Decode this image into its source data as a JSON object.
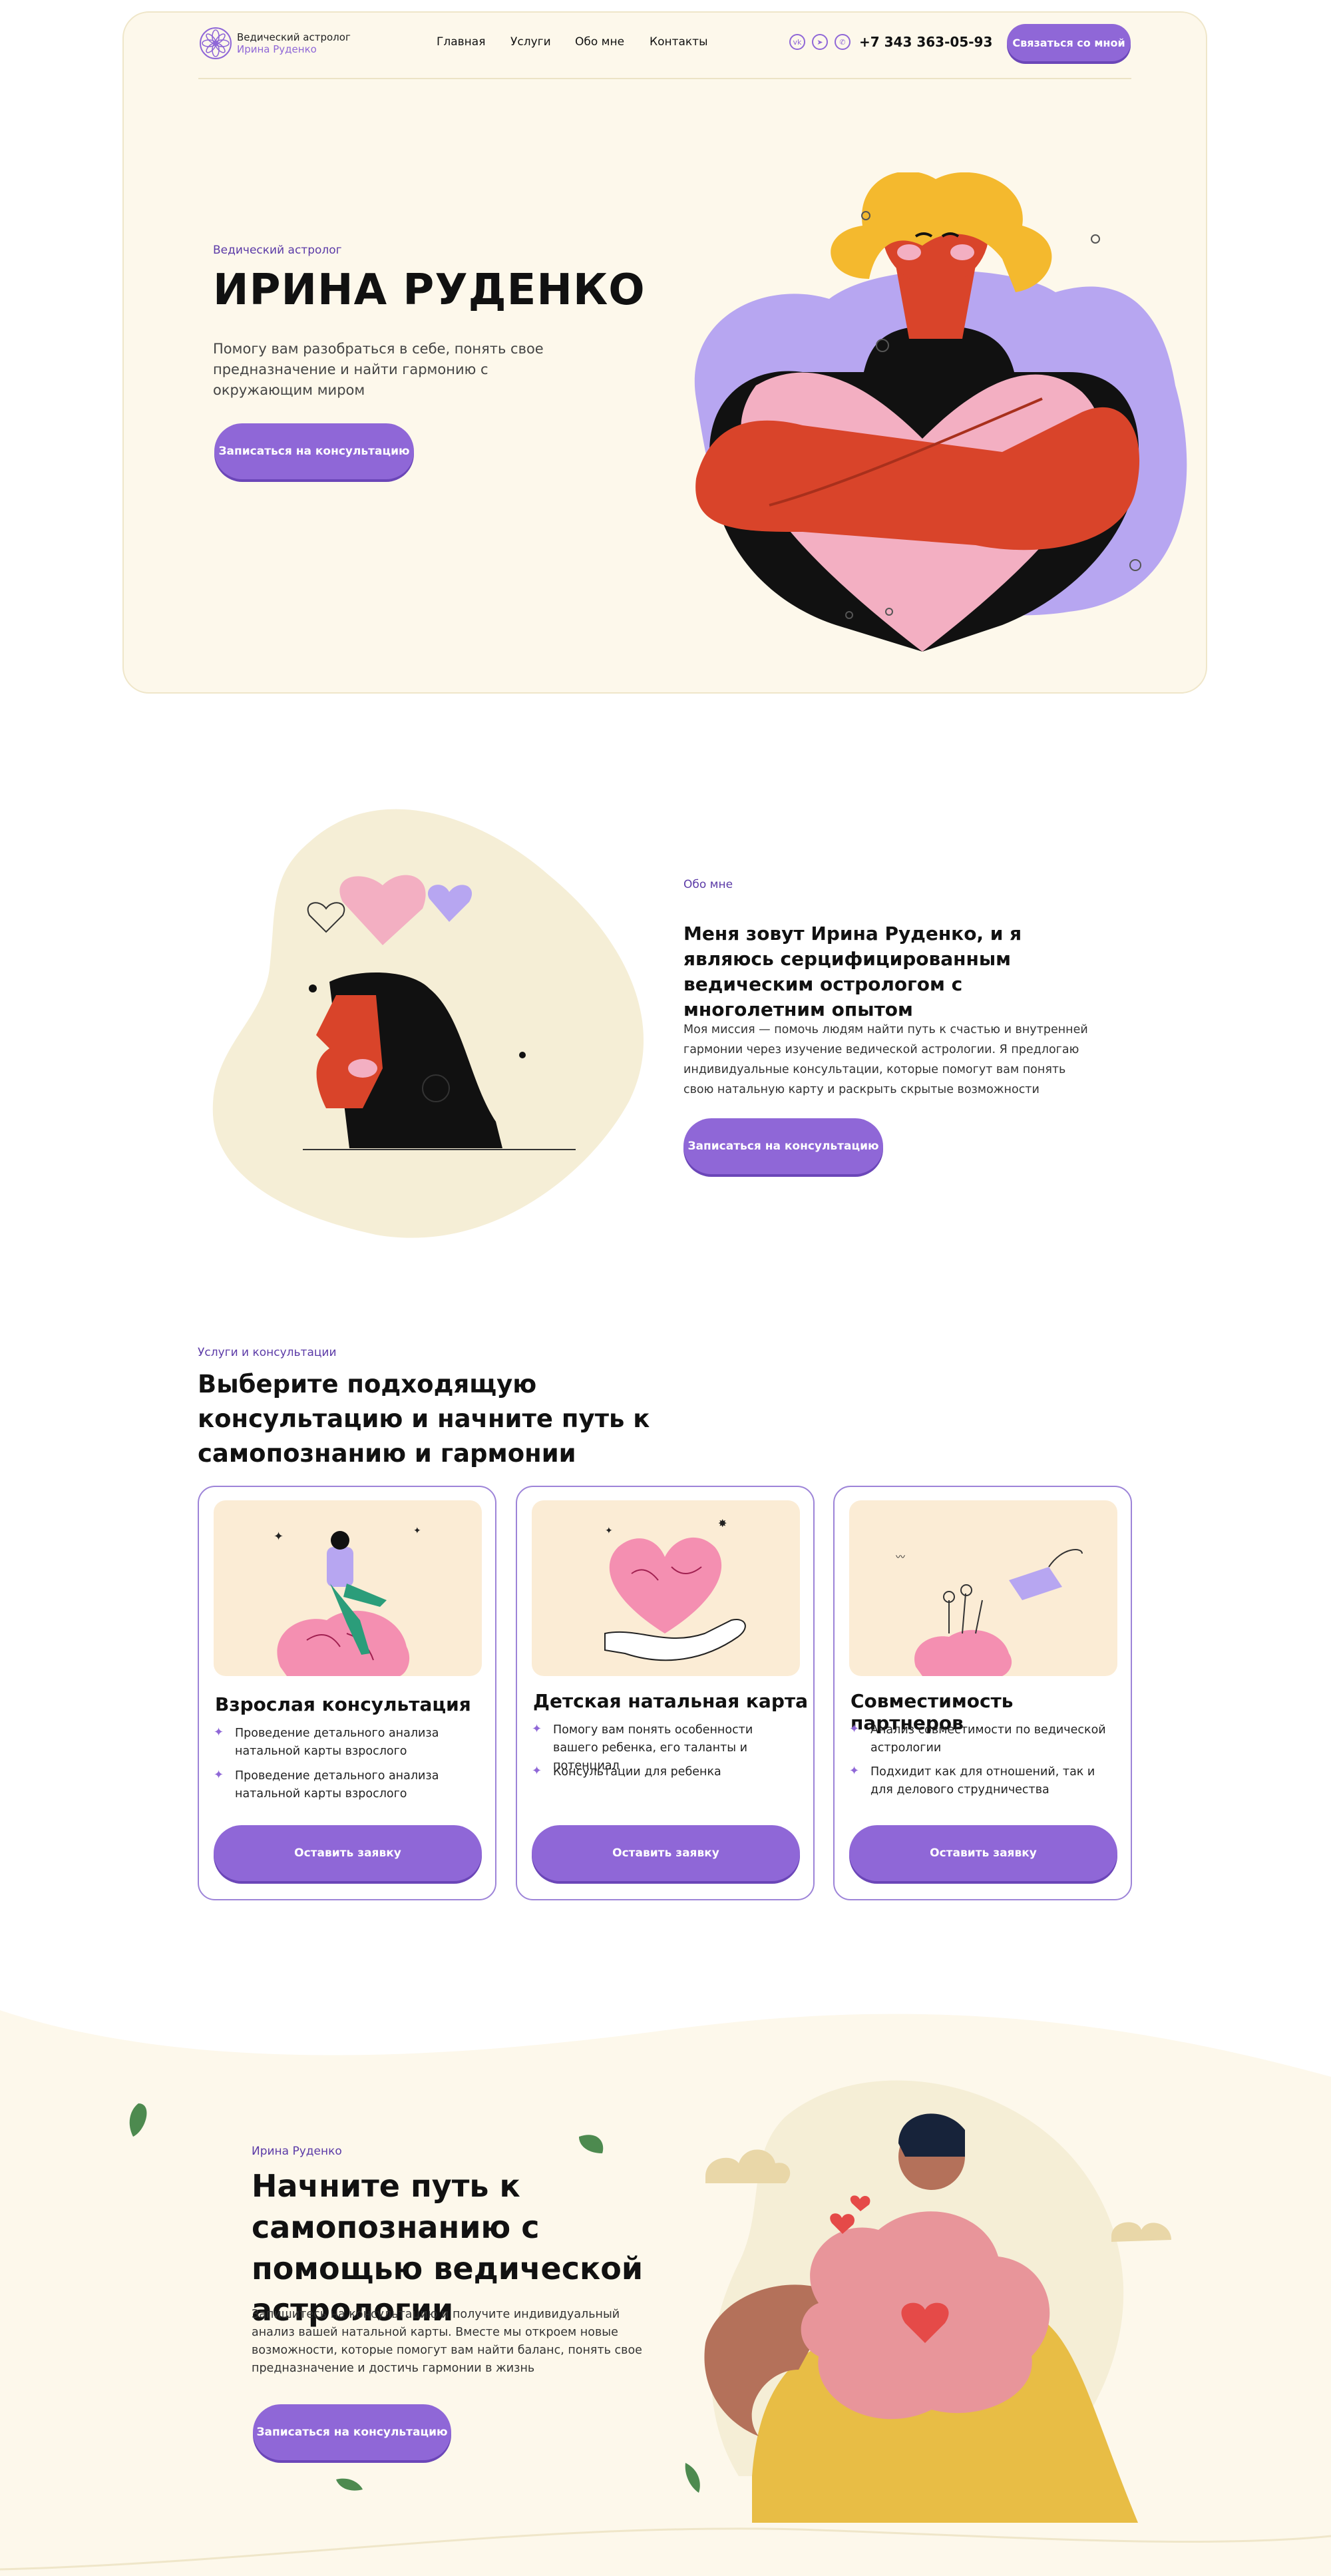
{
  "header": {
    "logo_line1": "Ведический астролог",
    "logo_line2": "Ирина Руденко",
    "nav": [
      "Главная",
      "Услуги",
      "Обо мне",
      "Контакты"
    ],
    "social": [
      "vk-icon",
      "telegram-icon",
      "whatsapp-icon"
    ],
    "phone": "+7 343 363-05-93",
    "contact_button": "Связаться со мной"
  },
  "hero": {
    "kicker": "Ведический астролог",
    "title": "ИРИНА РУДЕНКО",
    "description": "Помогу вам разобраться в себе, понять свое предназначение и найти гармонию с окружающим миром",
    "button": "Записаться на консультацию"
  },
  "about": {
    "kicker": "Обо мне",
    "heading": "Меня зовут Ирина Руденко, и я являюсь серцифицированным ведическим остpологом с многолетним опытом",
    "text": "Моя миссия — помочь людям найти путь к счастью и внутренней гармонии через изучение ведической астрологии. Я предлогаю индивидуальные консультации, которые помогут вам понять свою натальную карту и раскрыть скрытые возможности",
    "button": "Записаться на консультацию"
  },
  "services": {
    "kicker": "Услуги и консультации",
    "heading": "Выберите подходящую консультацию и начните путь к самопознанию и гармонии",
    "cards": [
      {
        "title": "Взрослая консультация",
        "items": [
          "Проведение детального анализа натальной карты взрослого",
          "Проведение детального анализа натальной карты взрослого"
        ],
        "button": "Оставить заявку"
      },
      {
        "title": "Детская натальная карта",
        "items": [
          "Помогу вам понять особенности вашего ребенка, его таланты и потенциал",
          "Консультации для ребенка"
        ],
        "button": "Оставить заявку"
      },
      {
        "title": "Совместимость партнеров",
        "items": [
          "Анализ совместимости по ведической астрологии",
          "Подхидит как для отношений, так и для делового струдничества"
        ],
        "button": "Оставить заявку"
      }
    ]
  },
  "cta": {
    "kicker": "Ирина Руденко",
    "heading": "Начните путь к самопознанию с помощью ведической астрологии",
    "text": "Запишитесь на консультацию и получите индивидуальный анализ вашей натальной карты. Вместе мы откроем новые возможности, которые помогут вам найти баланс, понять свое предназначение и достичь гармонии в жизнь",
    "button": "Записаться на консультацию"
  },
  "colors": {
    "accent": "#8f67d7",
    "cream": "#fdf8eb",
    "blob": "#f5eed6",
    "lilac": "#b7a6f1",
    "red": "#d9442a",
    "pink": "#f3afc2",
    "yellow": "#f4b92e"
  }
}
